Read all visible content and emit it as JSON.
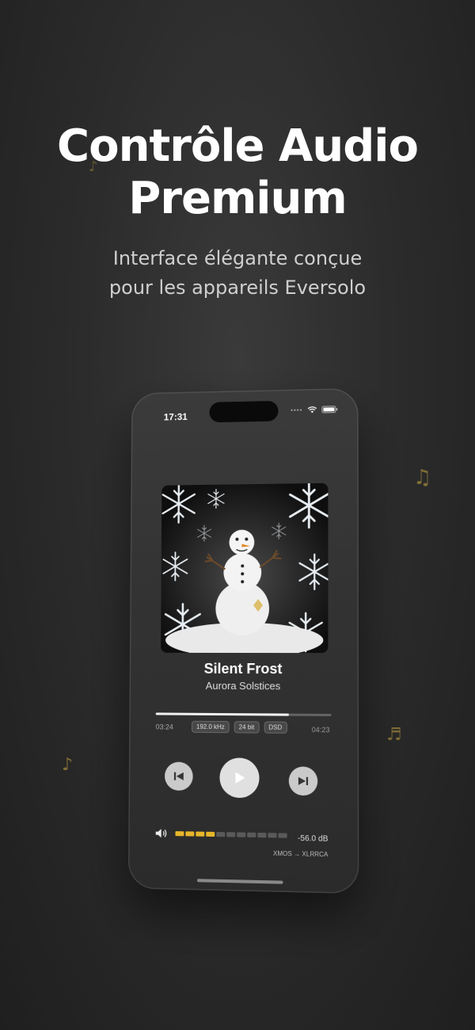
{
  "hero": {
    "title_line1": "Contrôle Audio",
    "title_line2": "Premium",
    "subtitle_line1": "Interface élégante conçue",
    "subtitle_line2": "pour les appareils Eversolo"
  },
  "decor": {
    "note_glyphs": [
      "♪",
      "♫",
      "♬",
      "♪"
    ],
    "accent_color": "#8f7a3a"
  },
  "phone": {
    "status": {
      "time": "17:31"
    },
    "track": {
      "title": "Silent Frost",
      "artist": "Aurora Solstices"
    },
    "playback": {
      "elapsed": "03:24",
      "total": "04:23",
      "progress_fraction": 0.76,
      "sample_rate": "192.0 kHz",
      "bit_depth": "24 bit",
      "format": "DSD"
    },
    "volume": {
      "db_label": "-56.0 dB",
      "level_segments_on": 4,
      "level_segments_total": 11,
      "meter_color": "#e7b62a"
    },
    "route": "XMOS → XLRRCA",
    "icons": [
      "previous-icon",
      "play-icon",
      "next-icon",
      "speaker-icon",
      "wifi-icon",
      "battery-icon"
    ]
  }
}
